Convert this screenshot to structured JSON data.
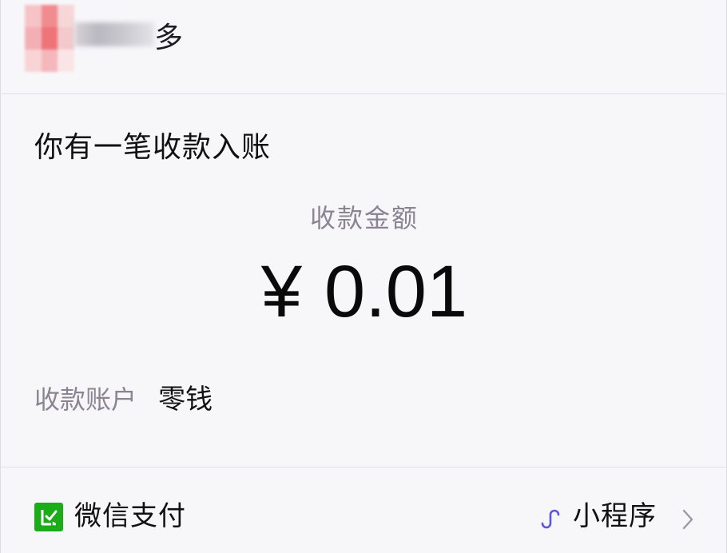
{
  "header": {
    "sender_name_visible": "多",
    "avatar_icon": "blurred-avatar"
  },
  "message": {
    "title": "你有一笔收款入账",
    "amount_label": "收款金额",
    "currency_symbol": "¥",
    "amount": "0.01",
    "account_label": "收款账户",
    "account_value": "零钱"
  },
  "footer": {
    "pay_icon": "wechat-pay-icon",
    "pay_label": "微信支付",
    "mini_program_icon": "mini-program-icon",
    "mini_program_label": "小程序",
    "chevron_icon": "chevron-right-icon"
  },
  "colors": {
    "background": "#f7f7fa",
    "wechat_green": "#1aad19",
    "mini_program_blue": "#5b57d9",
    "secondary_text": "#8a8493"
  }
}
